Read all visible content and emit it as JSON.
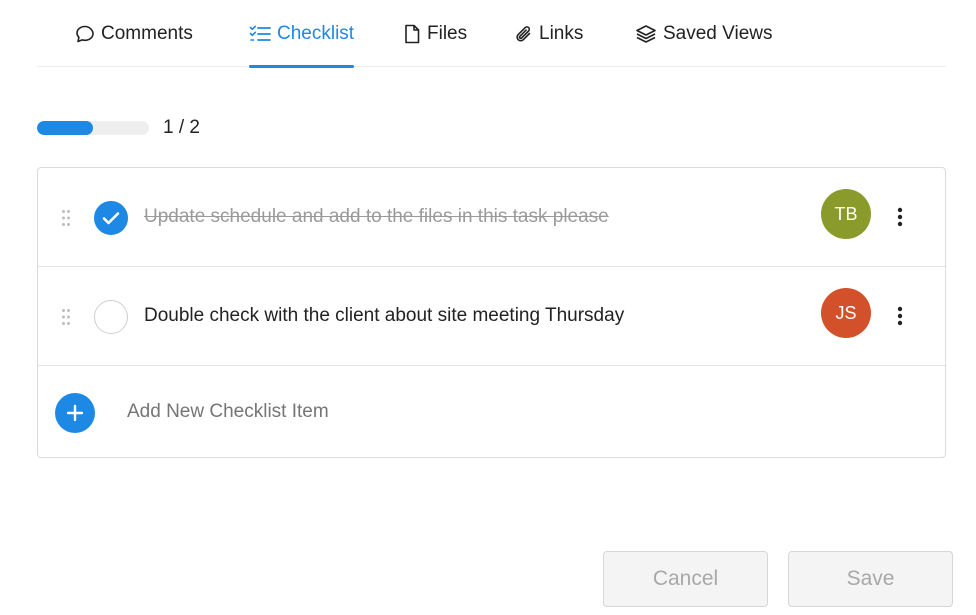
{
  "tabs": [
    {
      "label": "Comments",
      "icon": "comment-icon"
    },
    {
      "label": "Checklist",
      "icon": "checklist-icon"
    },
    {
      "label": "Files",
      "icon": "file-icon"
    },
    {
      "label": "Links",
      "icon": "paperclip-icon"
    },
    {
      "label": "Saved Views",
      "icon": "layers-icon"
    }
  ],
  "active_tab": "Checklist",
  "progress": {
    "completed": 1,
    "total": 2,
    "text": "1 / 2",
    "fraction": 0.5
  },
  "checklist": {
    "items": [
      {
        "text": "Update schedule and add to the files in this task please",
        "done": true,
        "assignee": "TB",
        "assignee_color": "#8a9a2b"
      },
      {
        "text": "Double check with the client about site meeting Thursday",
        "done": false,
        "assignee": "JS",
        "assignee_color": "#d2502a"
      }
    ],
    "add_placeholder": "Add New Checklist Item"
  },
  "actions": {
    "cancel_label": "Cancel",
    "save_label": "Save"
  },
  "colors": {
    "accent": "#1e88e5"
  }
}
